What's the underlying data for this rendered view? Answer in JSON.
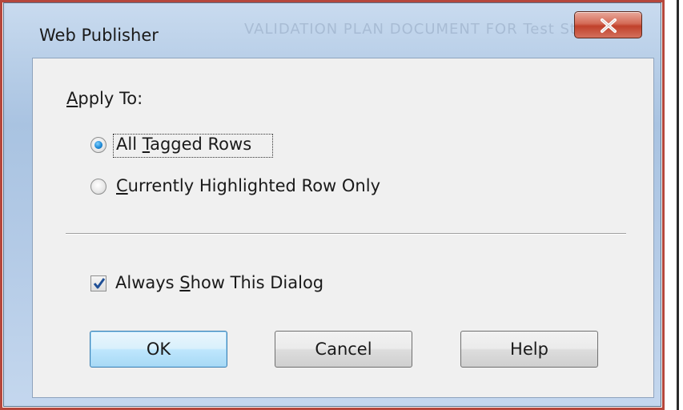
{
  "window": {
    "title": "Web Publisher",
    "background_title": "VALIDATION PLAN DOCUMENT FOR Test Studio"
  },
  "apply_to": {
    "label_prefix": "A",
    "label_rest": "pply To:",
    "options": [
      {
        "pre": "All ",
        "accel": "T",
        "post": "agged Rows",
        "selected": true
      },
      {
        "pre": "",
        "accel": "C",
        "post": "urrently Highlighted Row Only",
        "selected": false
      }
    ]
  },
  "always_show": {
    "pre": "Always ",
    "accel": "S",
    "post": "how This Dialog",
    "checked": true
  },
  "buttons": {
    "ok": "OK",
    "cancel": "Cancel",
    "help": "Help"
  },
  "colors": {
    "highlight_border": "#b5473c",
    "close_button": "#c0412b",
    "default_button": "#bee6fd"
  }
}
